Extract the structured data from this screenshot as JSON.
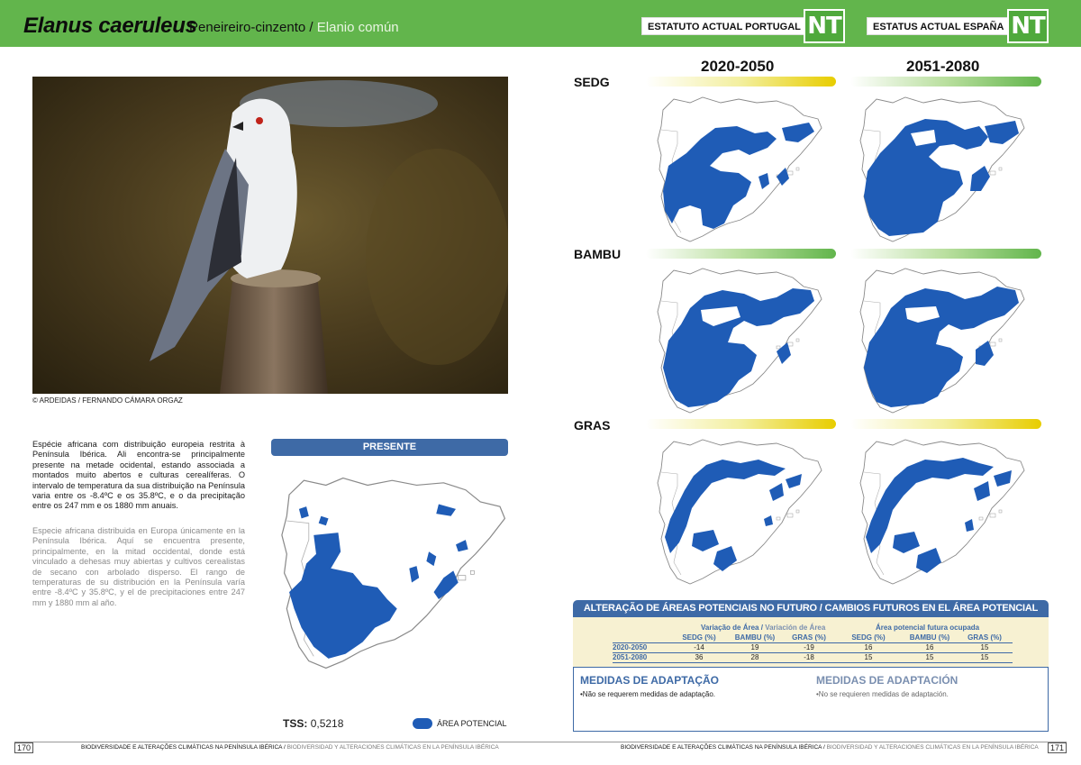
{
  "header": {
    "scientific_name": "Elanus caeruleus",
    "common_name_pt": "Peneireiro-cinzento",
    "separator": "/",
    "common_name_es": "Elanio común",
    "status_pt_label": "ESTATUTO ACTUAL PORTUGAL",
    "status_pt_value": "NT",
    "status_es_label": "ESTATUS ACTUAL ESPAÑA",
    "status_es_value": "NT"
  },
  "photo": {
    "credit": "© ARDEIDAS / FERNANDO CÁMARA ORGAZ"
  },
  "description": {
    "pt": "Espécie africana com distribuição europeia restrita à Península Ibérica. Ali encontra-se principalmente presente na metade ocidental, estando associada a montados muito abertos e culturas cerealíferas. O intervalo de temperatura da sua distribuição na Península varia entre os -8.4ºC e os 35.8ºC, e o da precipitação entre os 247 mm e os 1880 mm anuais.",
    "es": "Especie africana distribuida en Europa únicamente en la Península Ibérica. Aquí se encuentra presente, principalmente, en la mitad occidental, donde está vinculado a dehesas muy abiertas y cultivos cerealistas de secano con arbolado disperso. El rango de temperaturas de su distribución en la Península varía entre -8.4ºC y 35.8ºC, y el de precipitaciones entre 247 mm y 1880 mm al año."
  },
  "present": {
    "heading": "PRESENTE",
    "tss_label": "TSS:",
    "tss_value": "0,5218",
    "legend_label": "ÁREA POTENCIAL"
  },
  "projections": {
    "periods": [
      "2020-2050",
      "2051-2080"
    ],
    "scenarios": [
      "SEDG",
      "BAMBU",
      "GRAS"
    ]
  },
  "alteration": {
    "heading": "ALTERAÇÃO DE ÁREAS POTENCIAIS NO FUTURO / CAMBIOS FUTUROS EN EL ÁREA POTENCIAL",
    "group1_pt": "Variação de Área",
    "group1_sep": "/",
    "group1_es": "Variación de Área",
    "group2": "Área potencial futura ocupada",
    "columns": [
      "SEDG (%)",
      "BAMBU (%)",
      "GRAS (%)",
      "SEDG (%)",
      "BAMBU (%)",
      "GRAS (%)"
    ],
    "rows": [
      {
        "period": "2020-2050",
        "values": [
          "-14",
          "19",
          "-19",
          "16",
          "16",
          "15"
        ]
      },
      {
        "period": "2051-2080",
        "values": [
          "36",
          "28",
          "-18",
          "15",
          "15",
          "15"
        ]
      }
    ]
  },
  "measures": {
    "pt_title": "MEDIDAS DE ADAPTAÇÃO",
    "pt_text": "•Não se requerem medidas de adaptação.",
    "es_title": "MEDIDAS DE ADAPTACIÓN",
    "es_text": "•No se requieren medidas de adaptación."
  },
  "footer": {
    "left_page": "170",
    "right_page": "171",
    "title_pt": "BIODIVERSIDADE E ALTERAÇÕES CLIMÁTICAS NA PENÍNSULA IBÉRICA",
    "sep": "/",
    "title_es": "BIODIVERSIDAD Y ALTERACIONES CLIMÁTICAS EN LA PENÍNSULA IBÉRICA"
  },
  "colors": {
    "header_green": "#62b54c",
    "heading_blue": "#3e6aa6",
    "map_blue": "#1f5cb6"
  }
}
